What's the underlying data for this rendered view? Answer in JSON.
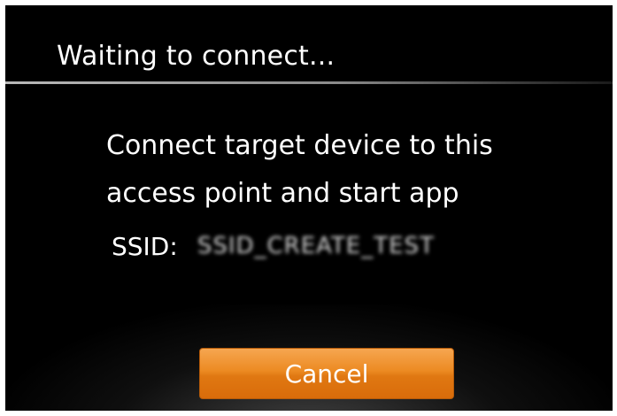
{
  "dialog": {
    "title": "Waiting to connect...",
    "message_line1": "Connect target device to this",
    "message_line2": "access point and start app",
    "ssid_label": "SSID:",
    "ssid_value": "SSID_CREATE_TEST",
    "cancel_label": "Cancel"
  },
  "colors": {
    "background": "#000000",
    "text": "#ffffff",
    "button_accent": "#ec8a22"
  }
}
